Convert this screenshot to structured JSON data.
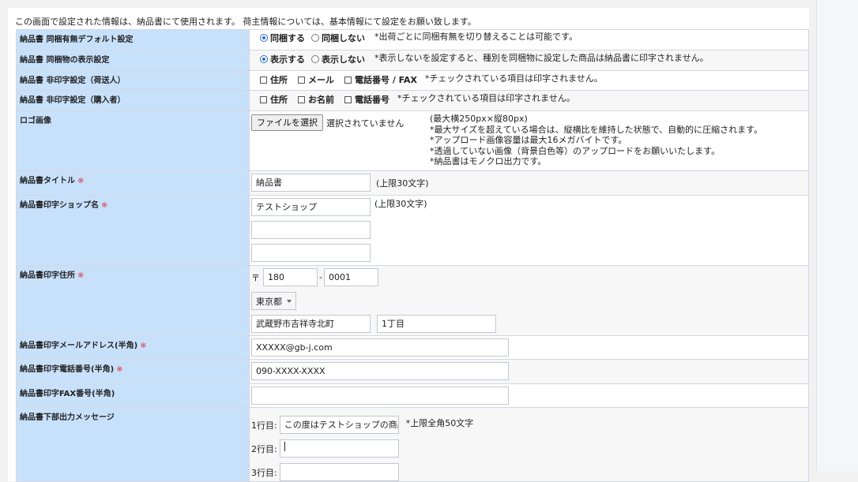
{
  "intro": "この画面で設定された情報は、納品書にて使用されます。 荷主情報については、基本情報にて設定をお願い致します。",
  "rows": {
    "bundle_default": {
      "label": "納品書 同梱有無デフォルト設定",
      "option_yes": "同梱する",
      "option_no": "同梱しない",
      "selected": "同梱する",
      "note": "*出荷ごとに同梱有無を切り替えることは可能です。"
    },
    "bundle_display": {
      "label": "納品書 同梱物の表示設定",
      "option_yes": "表示する",
      "option_no": "表示しない",
      "selected": "表示する",
      "note": "*表示しないを設定すると、種別を同梱物に設定した商品は納品書に印字されません。"
    },
    "noprint_sender": {
      "label": "納品書 非印字設定（荷送人）",
      "checks": [
        "住所",
        "メール",
        "電話番号 / FAX"
      ],
      "note": "*チェックされている項目は印字されません。"
    },
    "noprint_buyer": {
      "label": "納品書 非印字設定（購入者）",
      "checks": [
        "住所",
        "お名前",
        "電話番号"
      ],
      "note": "*チェックされている項目は印字されません。"
    },
    "logo": {
      "label": "ロゴ画像",
      "file_button": "ファイルを選択",
      "file_status": "選択されていません",
      "notes": [
        "(最大横250px×縦80px)",
        "*最大サイズを超えている場合は、縦横比を維持した状態で、自動的に圧縮されます。",
        "*アップロード画像容量は最大16メガバイトです。",
        "*透過していない画像（背景白色等）のアップロードをお願いいたします。",
        "*納品書はモノクロ出力です。"
      ]
    },
    "title": {
      "label": "納品書タイトル",
      "required_mark": "※",
      "value": "納品書",
      "limit": "(上限30文字)"
    },
    "shop_name": {
      "label": "納品書印字ショップ名",
      "required_mark": "※",
      "value1": "テストショップ",
      "value2": "",
      "value3": "",
      "limit": "(上限30文字)"
    },
    "address": {
      "label": "納品書印字住所",
      "required_mark": "※",
      "postal_mark": "〒",
      "zip1": "180",
      "zip_sep": "-",
      "zip2": "0001",
      "prefecture": "東京都",
      "city": "武蔵野市吉祥寺北町",
      "street": "1丁目"
    },
    "email": {
      "label": "納品書印字メールアドレス(半角)",
      "required_mark": "※",
      "value": "XXXXX@gb-j.com"
    },
    "phone": {
      "label": "納品書印字電話番号(半角)",
      "required_mark": "※",
      "value": "090-XXXX-XXXX"
    },
    "fax": {
      "label": "納品書印字FAX番号(半角)",
      "value": ""
    },
    "message": {
      "label": "納品書下部出力メッセージ",
      "line1_label": "1行目:",
      "line1_value": "この度はテストショップの商品",
      "limit": "*上限全角50文字",
      "line2_label": "2行目:",
      "line2_value": "",
      "line3_label": "3行目:",
      "line3_value": ""
    }
  }
}
